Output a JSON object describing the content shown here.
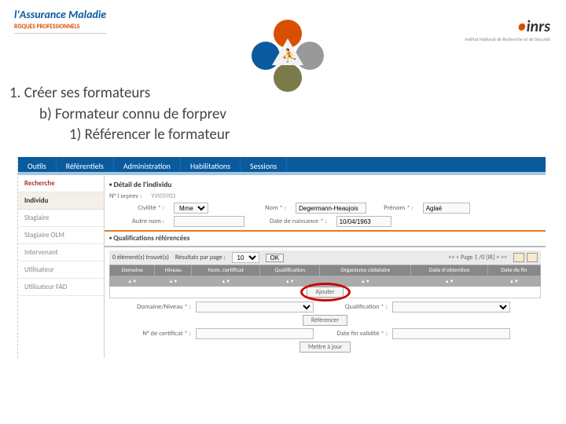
{
  "logos": {
    "left_main": "l'Assurance Maladie",
    "left_sub": "RISQUES PROFESSIONNELS",
    "right_main": "inrs",
    "right_sub": "Institut National de Recherche et de Sécurité"
  },
  "title": {
    "line1": "1.   Créer ses formateurs",
    "line2": "b)   Formateur connu de forprev",
    "line3": "1)   Référencer le formateur"
  },
  "menu": {
    "outils": "Outils",
    "referentiels": "Référentiels",
    "administration": "Administration",
    "habilitations": "Habilitations",
    "sessions": "Sessions"
  },
  "sidebar": {
    "recherche": "Recherche",
    "individu": "Individu",
    "stagiaire": "Stagiaire",
    "stagiaire_olm": "Stagiaire OLM",
    "intervenant": "Intervenant",
    "utilisateur": "Utilisateur",
    "utilisateur_fad": "Utilisateur FAD"
  },
  "detail": {
    "section": "Détail de l'individu",
    "forprev_lbl": "N° I orprev :",
    "forprev_val": "YVI05903",
    "civilite_lbl": "Civilité * :",
    "civilite_val": "Mme",
    "nom_lbl": "Nom * :",
    "nom_val": "Degermann-Heaujois",
    "prenom_lbl": "Prénom * :",
    "prenom_val": "Aglaé",
    "autre_nom_lbl": "Autre nom  :",
    "autre_nom_val": "",
    "dob_lbl": "Date de naissance * :",
    "dob_val": "10/04/1963"
  },
  "qual": {
    "section": "Qualifications référencées",
    "found": "0 élément(s) trouvé(s)",
    "per_page_lbl": "Résultats par page :",
    "per_page_val": "10",
    "ok": "OK",
    "pager": "<< < Page 1 /0 [IR] > >>",
    "cols": {
      "domaine": "Domaine",
      "niveau": "Niveau",
      "num_certif": "Num. certificat",
      "qualification": "Qualification",
      "organisme": "Organisme cédataire",
      "date_obt": "Date d'obtention",
      "date_fin": "Date de fin"
    },
    "ajouter": "Ajouter"
  },
  "form": {
    "domaine_lbl": "Domaine/Niveau * :",
    "qualification_lbl": "Qualification * :",
    "referencer": "Référencer",
    "certif_lbl": "N° de certificat * :",
    "certif_val": "",
    "datefin_lbl": "Date fin validité * :",
    "datefin_val": "",
    "mettre_a_jour": "Mettre à jour"
  }
}
